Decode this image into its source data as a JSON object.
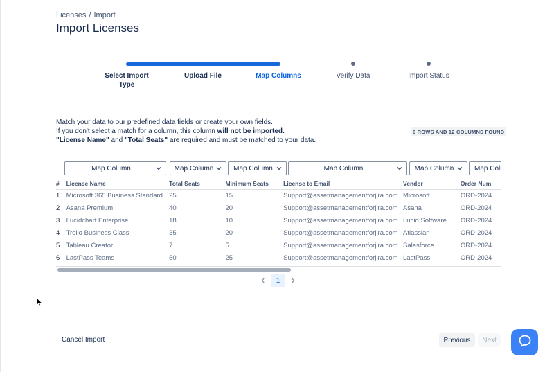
{
  "breadcrumb": {
    "root": "Licenses",
    "sep": "/",
    "current": "Import"
  },
  "page_title": "Import Licenses",
  "steps": [
    {
      "label": "Select Import Type",
      "state": "done"
    },
    {
      "label": "Upload File",
      "state": "done"
    },
    {
      "label": "Map Columns",
      "state": "active"
    },
    {
      "label": "Verify Data",
      "state": "pending"
    },
    {
      "label": "Import Status",
      "state": "pending"
    }
  ],
  "intro": {
    "line1": "Match your data to our predefined data fields or create your own fields.",
    "line2_pre": "If you don't select a match for a column, this column ",
    "line2_bold": "will not be imported.",
    "line3_b1": "\"License Name\"",
    "line3_mid": " and ",
    "line3_b2": "\"Total Seats\"",
    "line3_post": " are required and must be matched to your data."
  },
  "found_badge": "6 ROWS AND 12 COLUMNS FOUND",
  "map_placeholder": "Map Column",
  "table": {
    "headers": [
      "#",
      "License Name",
      "Total Seats",
      "Minimum Seats",
      "License to Email",
      "Vendor",
      "Order Num"
    ],
    "rows": [
      [
        "1",
        "Microsoft 365 Business Standard",
        "25",
        "15",
        "Support@assetmanagementforjira.com",
        "Microsoft",
        "ORD-2024"
      ],
      [
        "2",
        "Asana Premium",
        "40",
        "20",
        "Support@assetmanagementforjira.com",
        "Asana",
        "ORD-2024"
      ],
      [
        "3",
        "Lucidchart Enterprise",
        "18",
        "10",
        "Support@assetmanagementforjira.com",
        "Lucid Software",
        "ORD-2024"
      ],
      [
        "4",
        "Trello Business Class",
        "35",
        "20",
        "Support@assetmanagementforjira.com",
        "Atlassian",
        "ORD-2024"
      ],
      [
        "5",
        "Tableau Creator",
        "7",
        "5",
        "Support@assetmanagementforjira.com",
        "Salesforce",
        "ORD-2024"
      ],
      [
        "6",
        "LastPass Teams",
        "50",
        "25",
        "Support@assetmanagementforjira.com",
        "LastPass",
        "ORD-2024"
      ]
    ]
  },
  "pagination": {
    "current_page": "1"
  },
  "footer": {
    "cancel": "Cancel Import",
    "previous": "Previous",
    "next": "Next"
  },
  "colors": {
    "accent": "#0c66e4",
    "progress": "#1868db",
    "help_button": "#3b82f6"
  },
  "icons": {
    "select": "chevron-down-icon",
    "prev": "chevron-left-icon",
    "next": "chevron-right-icon",
    "help": "chat-bubble-icon"
  }
}
